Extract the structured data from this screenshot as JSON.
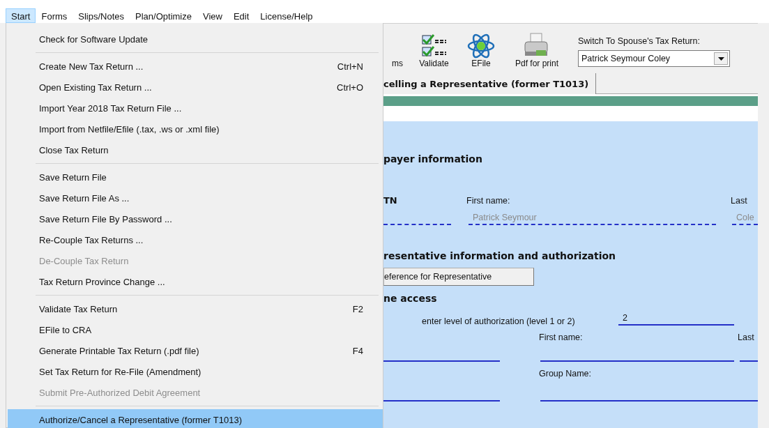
{
  "menu_bar": [
    {
      "label": "Start",
      "selected": true
    },
    {
      "label": "Forms",
      "selected": false
    },
    {
      "label": "Slips/Notes",
      "selected": false
    },
    {
      "label": "Plan/Optimize",
      "selected": false
    },
    {
      "label": "View",
      "selected": false
    },
    {
      "label": "Edit",
      "selected": false
    },
    {
      "label": "License/Help",
      "selected": false
    }
  ],
  "start_menu": [
    {
      "kind": "item",
      "label": "Check for Software Update",
      "disabled": false,
      "selected": false
    },
    {
      "kind": "separator"
    },
    {
      "kind": "item",
      "label": "Create New Tax Return ...",
      "shortcut": "Ctrl+N",
      "disabled": false,
      "selected": false
    },
    {
      "kind": "item",
      "label": "Open Existing Tax Return ...",
      "shortcut": "Ctrl+O",
      "disabled": false,
      "selected": false
    },
    {
      "kind": "item",
      "label": "Import Year 2018 Tax Return File ...",
      "disabled": false,
      "selected": false
    },
    {
      "kind": "item",
      "label": "Import from Netfile/Efile (.tax, .ws or .xml file)",
      "disabled": false,
      "selected": false
    },
    {
      "kind": "item",
      "label": "Close Tax Return",
      "disabled": false,
      "selected": false
    },
    {
      "kind": "separator"
    },
    {
      "kind": "item",
      "label": "Save Return File",
      "disabled": false,
      "selected": false
    },
    {
      "kind": "item",
      "label": "Save Return File As ...",
      "disabled": false,
      "selected": false
    },
    {
      "kind": "item",
      "label": "Save Return File By Password ...",
      "disabled": false,
      "selected": false
    },
    {
      "kind": "item",
      "label": "Re-Couple Tax Returns ...",
      "disabled": false,
      "selected": false
    },
    {
      "kind": "item",
      "label": "De-Couple Tax Return",
      "disabled": true,
      "selected": false
    },
    {
      "kind": "item",
      "label": "Tax Return Province Change ...",
      "disabled": false,
      "selected": false
    },
    {
      "kind": "separator"
    },
    {
      "kind": "item",
      "label": "Validate Tax Return",
      "shortcut": "F2",
      "disabled": false,
      "selected": false
    },
    {
      "kind": "item",
      "label": "EFile to CRA",
      "disabled": false,
      "selected": false
    },
    {
      "kind": "item",
      "label": "Generate Printable Tax Return (.pdf file)",
      "shortcut": "F4",
      "disabled": false,
      "selected": false
    },
    {
      "kind": "item",
      "label": "Set Tax Return for Re-File (Amendment)",
      "disabled": false,
      "selected": false
    },
    {
      "kind": "item",
      "label": "Submit Pre-Authorized Debit Agreement",
      "disabled": true,
      "selected": false
    },
    {
      "kind": "separator"
    },
    {
      "kind": "item",
      "label": "Authorize/Cancel a Representative (former T1013)",
      "disabled": false,
      "selected": true
    }
  ],
  "toolbar": [
    {
      "kind": "hidden",
      "label": "ms"
    },
    {
      "kind": "validate",
      "label": "Validate"
    },
    {
      "kind": "efile",
      "label": "EFile"
    },
    {
      "kind": "printer",
      "label": "Pdf for print"
    }
  ],
  "spouse_switch": {
    "label": "Switch To Spouse's Tax Return:",
    "value": "Patrick Seymour Coley"
  },
  "tab": {
    "label": "celling a Representative (former T1013)"
  },
  "taxpayer": {
    "heading": "payer information",
    "sin_label": "TN",
    "first_name_label": "First name:",
    "last_name_label": "Last",
    "first_name": "Patrick Seymour",
    "last_name": "Cole"
  },
  "representative": {
    "heading": "resentative information and authorization",
    "reference_button": "eference for Representative",
    "access_heading": "ne access",
    "level_label": "enter level of authorization (level 1 or 2)",
    "level": "2",
    "first_name_label": "First name:",
    "last_name_label": "Last",
    "group_name_label": "Group Name:"
  }
}
